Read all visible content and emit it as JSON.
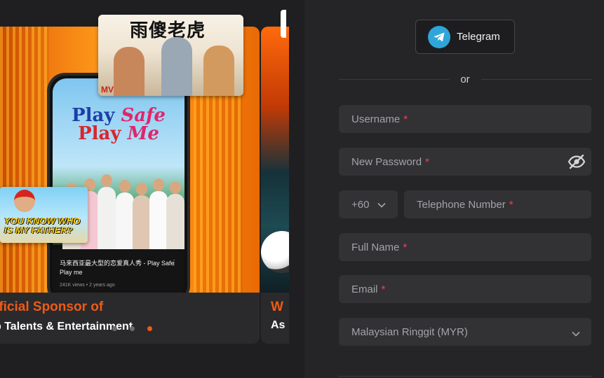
{
  "promo": {
    "card1": {
      "title_partial": "fficial Sponsor of",
      "subtitle_partial": "p Talents & Entertainment",
      "phone_video": {
        "show_title_line1": "Play",
        "show_title_line1b": "Safe",
        "show_title_line2": "Play",
        "show_title_line2b": "Me",
        "video_title": "马来西亚最大型的恋爱真人秀 - Play Safe Play me",
        "video_meta": "241K views • 2 years ago"
      },
      "thumb_top_title": "雨傻老虎",
      "thumb_top_badge": "MV",
      "thumb_left_title": "YOU KNOW WHO IS MY FATHER?"
    },
    "card2": {
      "title_partial": "W",
      "subtitle_partial": "As"
    },
    "carousel_dots": 3,
    "active_dot": 2,
    "accent_color": "#f05a14"
  },
  "form": {
    "telegram_label": "Telegram",
    "or_label": "or",
    "fields": {
      "username": "Username",
      "password": "New Password",
      "country_code": "+60",
      "telephone": "Telephone Number",
      "full_name": "Full Name",
      "email": "Email",
      "currency": "Malaysian Ringgit (MYR)"
    },
    "required_marker": "*",
    "required_color": "#ff3b4a"
  }
}
